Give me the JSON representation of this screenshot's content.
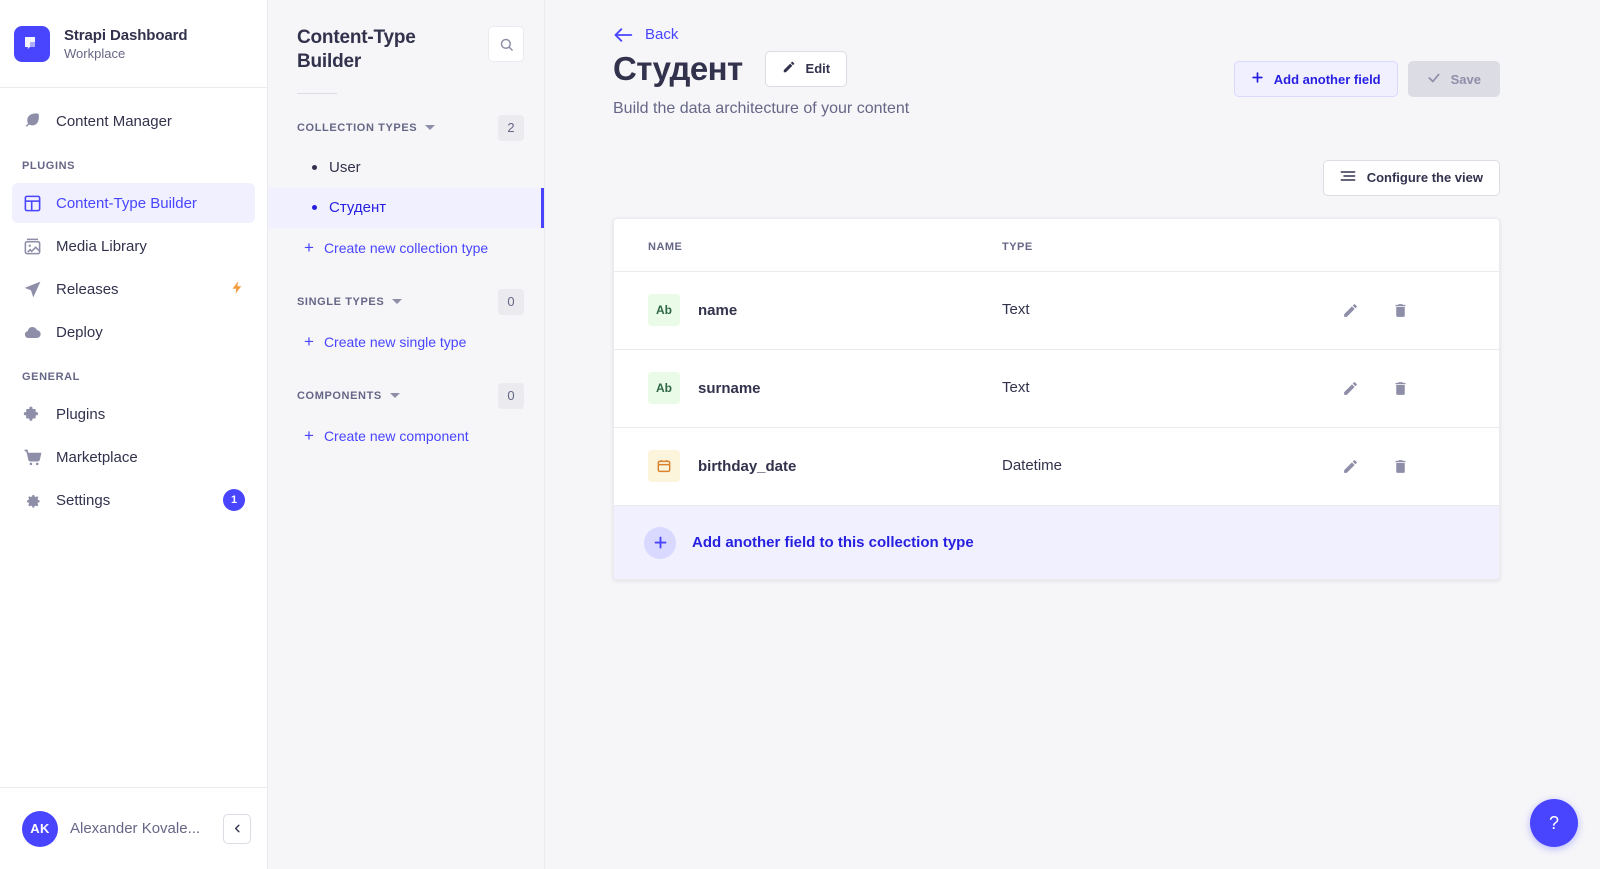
{
  "leftnav": {
    "brand": {
      "title": "Strapi Dashboard",
      "subtitle": "Workplace",
      "logo_icon": "strapi-logo-icon"
    },
    "items": [
      {
        "label": "Content Manager",
        "icon": "feather-icon",
        "active": false
      }
    ],
    "sections": [
      {
        "label": "PLUGINS",
        "items": [
          {
            "label": "Content-Type Builder",
            "icon": "layout-icon",
            "active": true
          },
          {
            "label": "Media Library",
            "icon": "image-icon",
            "active": false
          },
          {
            "label": "Releases",
            "icon": "paper-plane-icon",
            "active": false,
            "trailing": "bolt-icon"
          },
          {
            "label": "Deploy",
            "icon": "cloud-icon",
            "active": false
          }
        ]
      },
      {
        "label": "GENERAL",
        "items": [
          {
            "label": "Plugins",
            "icon": "puzzle-icon",
            "active": false
          },
          {
            "label": "Marketplace",
            "icon": "shopping-cart-icon",
            "active": false
          },
          {
            "label": "Settings",
            "icon": "gear-icon",
            "active": false,
            "badge": "1"
          }
        ]
      }
    ],
    "user": {
      "initials": "AK",
      "name": "Alexander Kovale...",
      "collapse_icon": "chevron-left-icon"
    }
  },
  "ctb": {
    "title": "Content-Type Builder",
    "search_icon": "search-icon",
    "groups": [
      {
        "label": "COLLECTION TYPES",
        "count": "2",
        "items": [
          {
            "label": "User",
            "selected": false
          },
          {
            "label": "Студент",
            "selected": true
          }
        ],
        "create_label": "Create new collection type"
      },
      {
        "label": "SINGLE TYPES",
        "count": "0",
        "items": [],
        "create_label": "Create new single type"
      },
      {
        "label": "COMPONENTS",
        "count": "0",
        "items": [],
        "create_label": "Create new component"
      }
    ]
  },
  "main": {
    "back_label": "Back",
    "page_title": "Студент",
    "edit_label": "Edit",
    "subtitle": "Build the data architecture of your content",
    "add_field_label": "Add another field",
    "save_label": "Save",
    "configure_label": "Configure the view",
    "table": {
      "columns": [
        "NAME",
        "TYPE",
        ""
      ],
      "rows": [
        {
          "icon": "text-field-icon",
          "icon_label": "Ab",
          "icon_kind": "text",
          "name": "name",
          "type": "Text"
        },
        {
          "icon": "text-field-icon",
          "icon_label": "Ab",
          "icon_kind": "text",
          "name": "surname",
          "type": "Text"
        },
        {
          "icon": "calendar-icon",
          "icon_label": "",
          "icon_kind": "date",
          "name": "birthday_date",
          "type": "Datetime"
        }
      ],
      "row_actions": {
        "edit_icon": "pencil-icon",
        "delete_icon": "trash-icon"
      }
    },
    "footer_label": "Add another field to this collection type",
    "help_label": "?"
  },
  "colors": {
    "accent": "#4945ff",
    "accent_dark": "#271fe0",
    "accent_bg": "#f0f0ff",
    "text": "#32324d",
    "muted": "#666687",
    "page_bg": "#f6f6f9",
    "border": "#eaeaef",
    "green_badge_bg": "#eafbe7",
    "green_badge_fg": "#2f6846",
    "orange_badge_bg": "#fdf4dc",
    "orange_badge_fg": "#d9822f",
    "bolt": "#f29d41"
  }
}
